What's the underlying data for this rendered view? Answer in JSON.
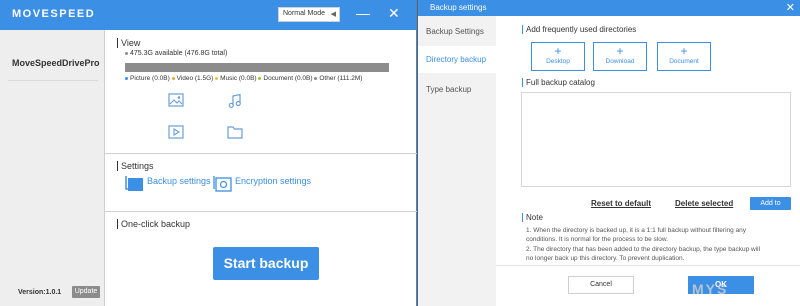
{
  "app": {
    "logo": "MOVESPEED",
    "mode": "Normal Mode",
    "drive_name": "MoveSpeedDrivePro",
    "version": "Version:1.0.1",
    "update_label": "Update"
  },
  "view": {
    "title": "View",
    "available": "475.3G available (476.8G total)",
    "legend": [
      {
        "label": "Picture (0.0B)",
        "color": "#3b8fe5"
      },
      {
        "label": "Video (1.5G)",
        "color": "#f2a33a"
      },
      {
        "label": "Music (0.0B)",
        "color": "#e8c43a"
      },
      {
        "label": "Document (0.0B)",
        "color": "#9bc53d"
      },
      {
        "label": "Other (111.2M)",
        "color": "#8c8c8c"
      }
    ],
    "category_icons": [
      "image-icon",
      "music-icon",
      "video-icon",
      "folder-icon"
    ]
  },
  "settings": {
    "title": "Settings",
    "backup_label": "Backup settings",
    "encryption_label": "Encryption settings"
  },
  "oneclick": {
    "title": "One-click backup",
    "start_label": "Start backup"
  },
  "dialog": {
    "title": "Backup settings",
    "close": "✕",
    "side_items": [
      "Backup Settings",
      "Directory backup",
      "Type backup"
    ],
    "frequent_title": "Add frequently used directories",
    "dir_buttons": [
      "Desktop",
      "Download",
      "Document"
    ],
    "catalog_title": "Full backup catalog",
    "reset_label": "Reset to default",
    "delete_label": "Delete selected",
    "addto_label": "Add to",
    "note_title": "Note",
    "note_lines": [
      "1. When the directory is backed up, it is a 1:1 full backup without filtering any",
      "conditions. It is normal for the process to be slow.",
      "2. The directory that has been added to the directory backup, the type backup will",
      "no longer back up this directory. To prevent duplication."
    ],
    "cancel_label": "Cancel",
    "ok_label": "OK"
  },
  "watermark": "MYS"
}
